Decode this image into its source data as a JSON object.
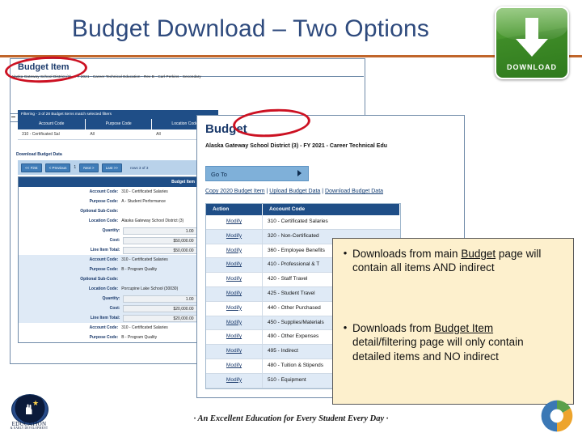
{
  "slide": {
    "title": "Budget Download – Two Options",
    "title_color": "#2e4a7d",
    "rule_color": "#c0652a"
  },
  "download_graphic": {
    "label": "DOWNLOAD",
    "icon": "down-arrow-icon",
    "color": "#3f8c28"
  },
  "budget_item_window": {
    "window_title": "Budget Item",
    "breadcrumb": "Alaska Gateway School District (3) - FY 2021 - Career Technical Education - Rev B - Carl Perkins - Secondary",
    "filter": {
      "status": "Filtering - 3 of 28 Budget Items match selected filters",
      "columns": [
        "Account Code",
        "Purpose Code",
        "Location Code"
      ],
      "row": [
        "310 - Certificated Sal",
        "All",
        "All"
      ]
    },
    "download_link": "Download Budget Data",
    "pager": {
      "first": "<< First",
      "previous": "< Previous",
      "page": "1",
      "next": "Next >",
      "last": "Last >>",
      "status": "rows  3 of 3"
    },
    "detail_header": "Budget Item",
    "detail_groups": [
      {
        "rows": [
          {
            "label": "Account Code:",
            "value": "310 - Certificated Salaries",
            "boxed": false
          },
          {
            "label": "Purpose Code:",
            "value": "A - Student Performance",
            "boxed": false
          },
          {
            "label": "Optional Sub-Code:",
            "value": "",
            "boxed": false
          },
          {
            "label": "Location Code:",
            "value": "Alaska Gateway School District (3)",
            "boxed": false
          },
          {
            "label": "Quantity:",
            "value": "1.00",
            "boxed": true
          },
          {
            "label": "Cost:",
            "value": "$50,000.00",
            "boxed": true
          },
          {
            "label": "Line Item Total:",
            "value": "$50,000.00",
            "boxed": true
          }
        ]
      },
      {
        "rows": [
          {
            "label": "Account Code:",
            "value": "310 - Certificated Salaries",
            "boxed": false
          },
          {
            "label": "Purpose Code:",
            "value": "B - Program Quality",
            "boxed": false
          },
          {
            "label": "Optional Sub-Code:",
            "value": "",
            "boxed": false
          },
          {
            "label": "Location Code:",
            "value": "Porcupine Lake School (30030)",
            "boxed": false
          },
          {
            "label": "Quantity:",
            "value": "1.00",
            "boxed": true
          },
          {
            "label": "Cost:",
            "value": "$20,000.00",
            "boxed": true
          },
          {
            "label": "Line Item Total:",
            "value": "$20,000.00",
            "boxed": true
          }
        ]
      },
      {
        "rows": [
          {
            "label": "Account Code:",
            "value": "310 - Certificated Salaries",
            "boxed": false
          },
          {
            "label": "Purpose Code:",
            "value": "B - Program Quality",
            "boxed": false
          }
        ]
      }
    ]
  },
  "budget_window": {
    "title": "Budget",
    "subtitle": "Alaska Gateway School District (3) - FY 2021 - Career Technical Edu",
    "goto_label": "Go To",
    "links": {
      "copy": "Copy 2020 Budget Item",
      "upload": "Upload Budget Data",
      "download": "Download Budget Data",
      "separator": " | "
    },
    "table": {
      "columns": [
        "Action",
        "Account Code"
      ],
      "rows": [
        {
          "action": "Modify",
          "account_code": "310 - Certificated Salaries"
        },
        {
          "action": "Modify",
          "account_code": "320 - Non-Certificated"
        },
        {
          "action": "Modify",
          "account_code": "360 - Employee Benefits"
        },
        {
          "action": "Modify",
          "account_code": "410 - Professional & T"
        },
        {
          "action": "Modify",
          "account_code": "420 - Staff Travel"
        },
        {
          "action": "Modify",
          "account_code": "425 - Student Travel"
        },
        {
          "action": "Modify",
          "account_code": "440 - Other Purchased"
        },
        {
          "action": "Modify",
          "account_code": "450 - Supplies/Materials"
        },
        {
          "action": "Modify",
          "account_code": "490 - Other Expenses"
        },
        {
          "action": "Modify",
          "account_code": "495 - Indirect"
        },
        {
          "action": "Modify",
          "account_code": "480 - Tuition & Stipends"
        },
        {
          "action": "Modify",
          "account_code": "510 - Equipment"
        }
      ]
    }
  },
  "callout": {
    "background": "#fdf0cd",
    "bullets": [
      {
        "bullet": "•",
        "pre": "Downloads from main ",
        "underlined": "Budget",
        "post": " page will contain all items AND indirect"
      },
      {
        "bullet": "•",
        "pre": "Downloads from ",
        "underlined": "Budget Item",
        "post": " detail/filtering page will only contain detailed items and NO indirect"
      }
    ]
  },
  "footer": {
    "motto": "· An Excellent Education for Every Student Every Day ·",
    "seal_line1": "EDUCATION",
    "seal_line2": "& EARLY DEVELOPMENT",
    "logo": "tri-color-circle-logo"
  }
}
